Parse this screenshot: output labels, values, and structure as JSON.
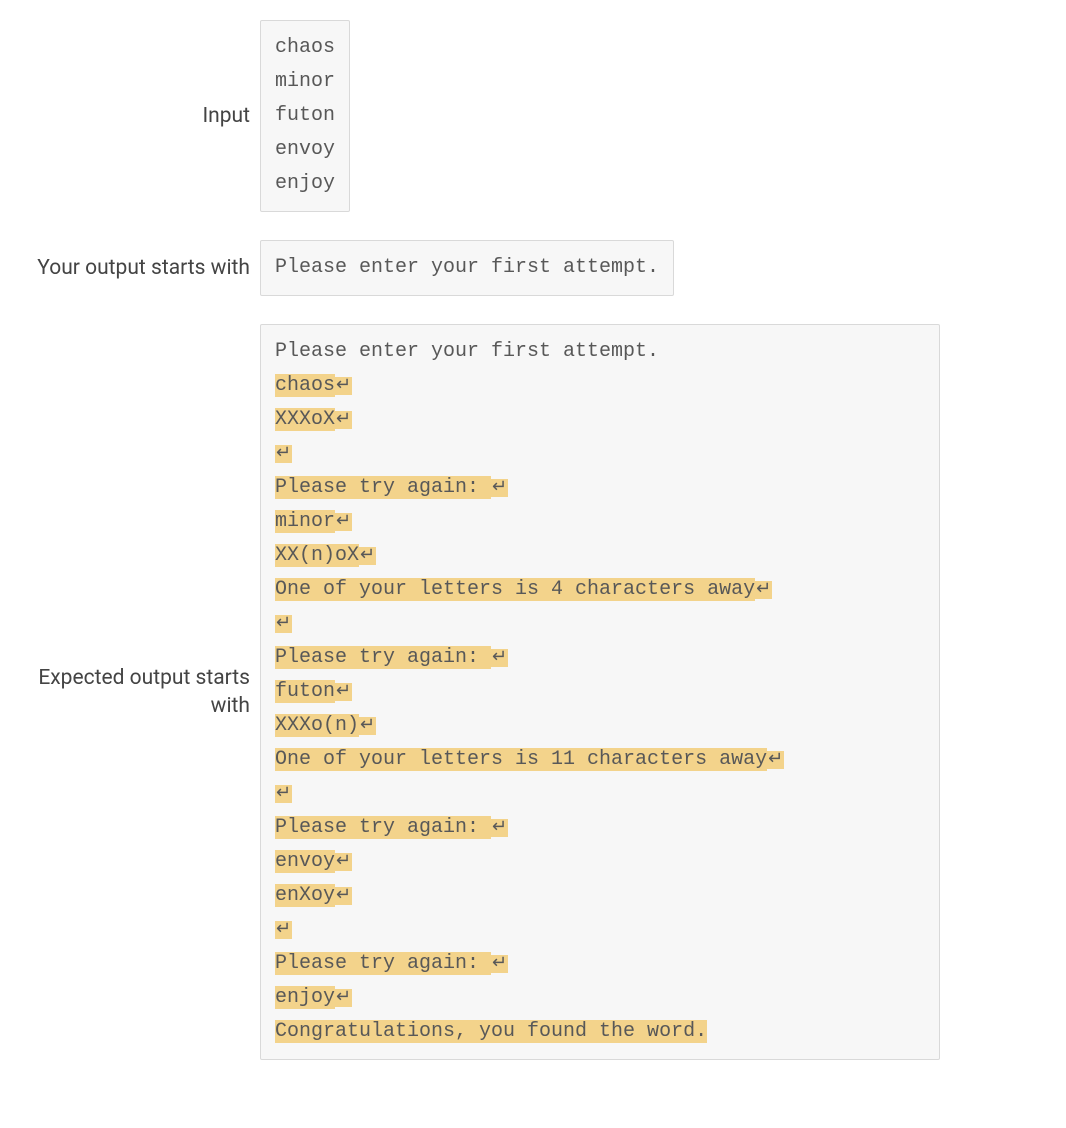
{
  "labels": {
    "input": "Input",
    "your_output": "Your output starts with",
    "expected": "Expected output starts with"
  },
  "glyphs": {
    "newline": "↵"
  },
  "input_lines": [
    "chaos",
    "minor",
    "futon",
    "envoy",
    "enjoy"
  ],
  "your_output_line": "Please enter your first attempt.",
  "expected": {
    "prompt": "Please enter your first attempt.",
    "attempts": [
      {
        "guess": "chaos",
        "feedback": "XXXoX",
        "hint": ""
      },
      {
        "guess": "minor",
        "feedback": "XX(n)oX",
        "hint": "One of your letters is 4 characters away"
      },
      {
        "guess": "futon",
        "feedback": "XXXo(n)",
        "hint": "One of your letters is 11 characters away"
      },
      {
        "guess": "envoy",
        "feedback": "enXoy",
        "hint": ""
      }
    ],
    "retry_text": "Please try again: ",
    "final_guess": "enjoy",
    "success": "Congratulations, you found the word."
  }
}
